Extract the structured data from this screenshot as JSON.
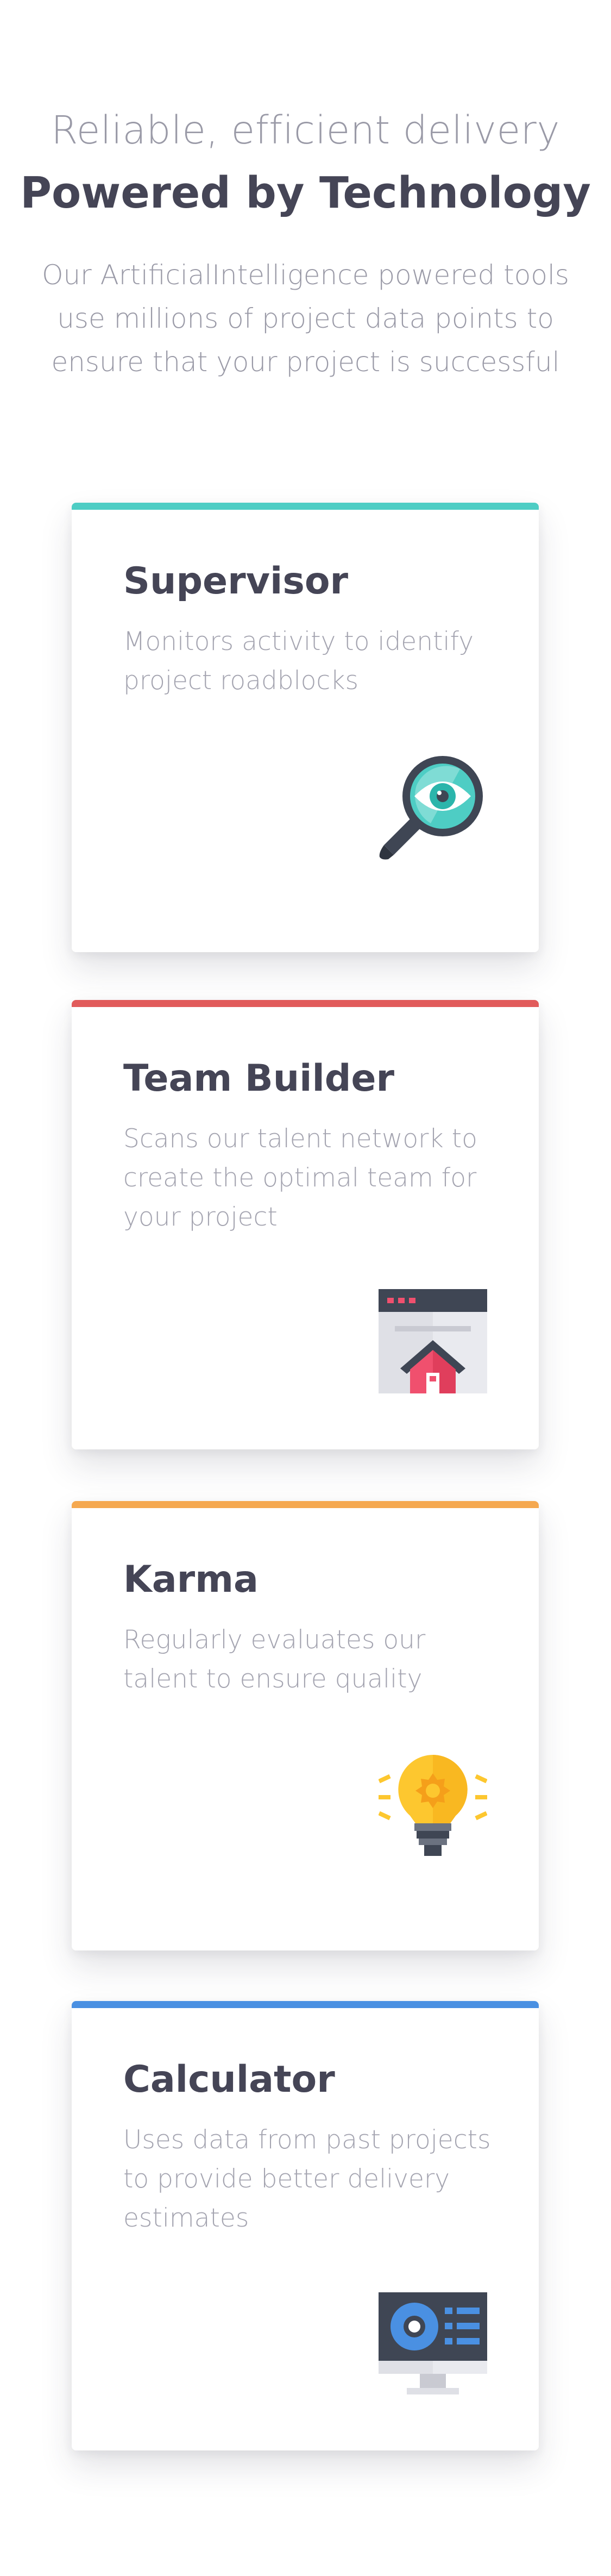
{
  "hero": {
    "eyebrow": "Reliable, efficient delivery",
    "title": "Powered by Technology",
    "lead": "Our ArtificialIntelligence powered tools use millions of project data points to ensure that your project is successful"
  },
  "cards": [
    {
      "title": "Supervisor",
      "description": "Monitors activity to identify project roadblocks",
      "accent": "#4ecdc4",
      "icon": "magnifier-eye-icon"
    },
    {
      "title": "Team Builder",
      "description": "Scans our talent network to create the optimal team for your project",
      "accent": "#e15b5b",
      "icon": "browser-house-icon"
    },
    {
      "title": "Karma",
      "description": "Regularly evaluates our talent to ensure quality",
      "accent": "#f5a84f",
      "icon": "lightbulb-icon"
    },
    {
      "title": "Calculator",
      "description": "Uses data from past projects to provide better delivery estimates",
      "accent": "#4a90e2",
      "icon": "monitor-dashboard-icon"
    }
  ]
}
